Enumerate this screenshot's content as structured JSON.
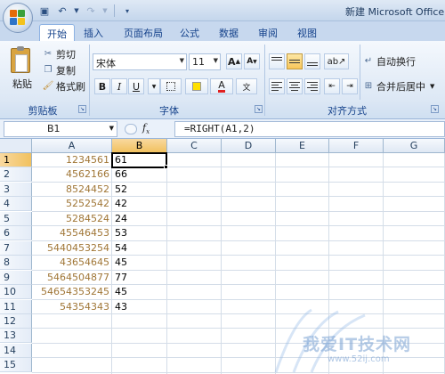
{
  "window": {
    "title": "新建 Microsoft Office"
  },
  "tabs": [
    {
      "label": "开始",
      "active": true
    },
    {
      "label": "插入"
    },
    {
      "label": "页面布局"
    },
    {
      "label": "公式"
    },
    {
      "label": "数据"
    },
    {
      "label": "审阅"
    },
    {
      "label": "视图"
    }
  ],
  "clipboard": {
    "paste": "粘贴",
    "cut": "剪切",
    "copy": "复制",
    "format_painter": "格式刷",
    "group_label": "剪贴板"
  },
  "font": {
    "name": "宋体",
    "size": "11",
    "group_label": "字体"
  },
  "alignment": {
    "wrap_text": "自动换行",
    "merge_center": "合并后居中",
    "group_label": "对齐方式"
  },
  "formula_bar": {
    "name_box": "B1",
    "formula": "=RIGHT(A1,2)"
  },
  "columns": [
    "A",
    "B",
    "C",
    "D",
    "E",
    "F",
    "G"
  ],
  "rows": [
    {
      "n": "1",
      "a": "1234561",
      "b": "61"
    },
    {
      "n": "2",
      "a": "4562166",
      "b": "66"
    },
    {
      "n": "3",
      "a": "8524452",
      "b": "52"
    },
    {
      "n": "4",
      "a": "5252542",
      "b": "42"
    },
    {
      "n": "5",
      "a": "5284524",
      "b": "24"
    },
    {
      "n": "6",
      "a": "45546453",
      "b": "53"
    },
    {
      "n": "7",
      "a": "5440453254",
      "b": "54"
    },
    {
      "n": "8",
      "a": "43654645",
      "b": "45"
    },
    {
      "n": "9",
      "a": "5464504877",
      "b": "77"
    },
    {
      "n": "10",
      "a": "54654353245",
      "b": "45"
    },
    {
      "n": "11",
      "a": "54354343",
      "b": "43"
    },
    {
      "n": "12",
      "a": "",
      "b": ""
    },
    {
      "n": "13",
      "a": "",
      "b": ""
    },
    {
      "n": "14",
      "a": "",
      "b": ""
    },
    {
      "n": "15",
      "a": "",
      "b": ""
    }
  ],
  "watermark": {
    "text": "我爱IT技术网",
    "url": "www.52ij.com"
  },
  "colors": {
    "ribbon": "#dde8f5",
    "selection": "#f1c15f",
    "cell_a_text": "#a07636"
  }
}
